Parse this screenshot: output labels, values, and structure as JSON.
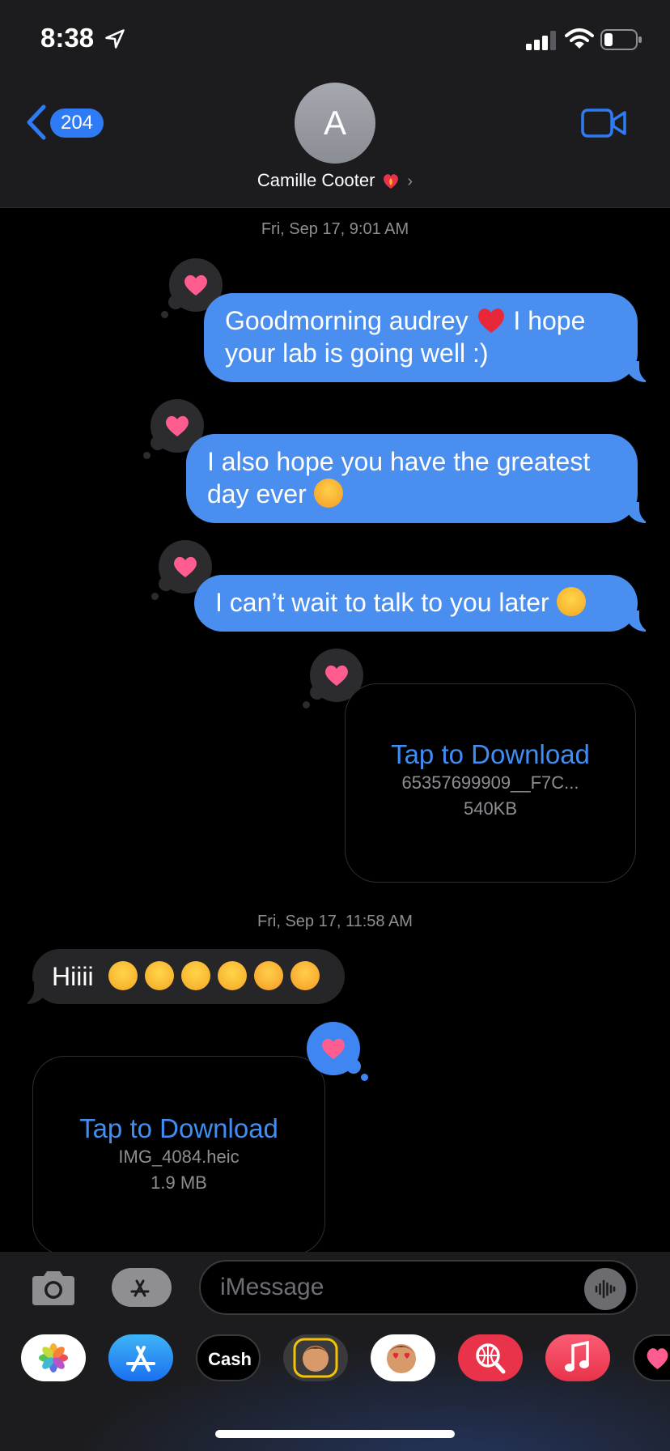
{
  "status_bar": {
    "time": "8:38"
  },
  "header": {
    "back_count": "204",
    "avatar_initial": "A",
    "contact_name": "Camille Cooter",
    "chevron": "›"
  },
  "conversation": {
    "timestamp_1": "Fri, Sep 17, 9:01 AM",
    "timestamp_2": "Fri, Sep 17, 11:58 AM",
    "msg1_part1": "Goodmorning audrey",
    "msg1_part2": "I hope your lab is going well :)",
    "msg2_part1": "I also hope you have the greatest day ever",
    "msg3": "I can’t wait to talk to you later",
    "attachment_1": {
      "action": "Tap to Download",
      "filename": "65357699909__F7C...",
      "size": "540KB"
    },
    "received_text": "Hiiii",
    "attachment_2": {
      "action": "Tap to Download",
      "filename": "IMG_4084.heic",
      "size": "1.9 MB"
    },
    "tapback": "heart"
  },
  "input": {
    "placeholder": "iMessage"
  },
  "app_drawer": {
    "apps": [
      "photos-app",
      "app-store-app",
      "apple-cash-app",
      "memoji-app",
      "animoji-app",
      "image-search-app",
      "music-app",
      "digital-touch-app"
    ],
    "cash_label": "Cash"
  },
  "colors": {
    "blue_bubble": "#4a8ff0",
    "link_blue": "#3f8ef5",
    "received_bubble": "#262628",
    "tapback_heart": "#ff5c8f"
  }
}
